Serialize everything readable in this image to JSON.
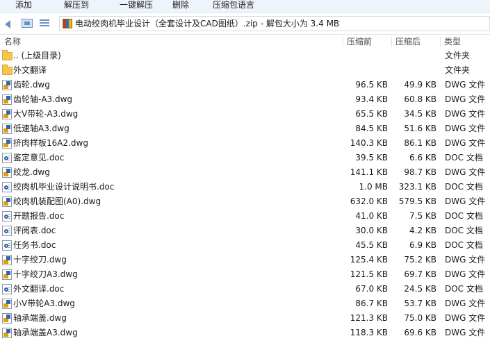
{
  "toolbar": {
    "buttons": [
      {
        "label": "添加"
      },
      {
        "label": "解压到"
      },
      {
        "label": "一键解压"
      },
      {
        "label": "删除"
      },
      {
        "label": "压缩包语言"
      }
    ]
  },
  "address": {
    "path": "电动绞肉机毕业设计（全套设计及CAD图纸）.zip - 解包大小为 3.4 MB"
  },
  "columns": {
    "name": "名称",
    "before": "压缩前",
    "after": "压缩后",
    "type": "类型"
  },
  "files": [
    {
      "name": ".. (上级目录)",
      "before": "",
      "after": "",
      "type": "文件夹",
      "icon": "folder-icon"
    },
    {
      "name": "外文翻译",
      "before": "",
      "after": "",
      "type": "文件夹",
      "icon": "folder-icon"
    },
    {
      "name": "齿轮.dwg",
      "before": "96.5 KB",
      "after": "49.9 KB",
      "type": "DWG 文件",
      "icon": "dwg-file-icon"
    },
    {
      "name": "齿轮轴-A3.dwg",
      "before": "93.4 KB",
      "after": "60.8 KB",
      "type": "DWG 文件",
      "icon": "dwg-file-icon"
    },
    {
      "name": "大V带轮-A3.dwg",
      "before": "65.5 KB",
      "after": "34.5 KB",
      "type": "DWG 文件",
      "icon": "dwg-file-icon"
    },
    {
      "name": "低速轴A3.dwg",
      "before": "84.5 KB",
      "after": "51.6 KB",
      "type": "DWG 文件",
      "icon": "dwg-file-icon"
    },
    {
      "name": "挤肉样板16A2.dwg",
      "before": "140.3 KB",
      "after": "86.1 KB",
      "type": "DWG 文件",
      "icon": "dwg-file-icon"
    },
    {
      "name": "鉴定意见.doc",
      "before": "39.5 KB",
      "after": "6.6 KB",
      "type": "DOC 文档",
      "icon": "doc-file-icon"
    },
    {
      "name": "绞龙.dwg",
      "before": "141.1 KB",
      "after": "98.7 KB",
      "type": "DWG 文件",
      "icon": "dwg-file-icon"
    },
    {
      "name": "绞肉机毕业设计说明书.doc",
      "before": "1.0 MB",
      "after": "323.1 KB",
      "type": "DOC 文档",
      "icon": "doc-file-icon"
    },
    {
      "name": "绞肉机装配图(A0).dwg",
      "before": "632.0 KB",
      "after": "579.5 KB",
      "type": "DWG 文件",
      "icon": "dwg-file-icon"
    },
    {
      "name": "开题报告.doc",
      "before": "41.0 KB",
      "after": "7.5 KB",
      "type": "DOC 文档",
      "icon": "doc-file-icon"
    },
    {
      "name": "评阅表.doc",
      "before": "30.0 KB",
      "after": "4.2 KB",
      "type": "DOC 文档",
      "icon": "doc-file-icon"
    },
    {
      "name": "任务书.doc",
      "before": "45.5 KB",
      "after": "6.9 KB",
      "type": "DOC 文档",
      "icon": "doc-file-icon"
    },
    {
      "name": "十字绞刀.dwg",
      "before": "125.4 KB",
      "after": "75.2 KB",
      "type": "DWG 文件",
      "icon": "dwg-file-icon"
    },
    {
      "name": "十字绞刀A3.dwg",
      "before": "121.5 KB",
      "after": "69.7 KB",
      "type": "DWG 文件",
      "icon": "dwg-file-icon"
    },
    {
      "name": "外文翻译.doc",
      "before": "67.0 KB",
      "after": "24.5 KB",
      "type": "DOC 文档",
      "icon": "doc-file-icon"
    },
    {
      "name": "小V带轮A3.dwg",
      "before": "86.7 KB",
      "after": "53.7 KB",
      "type": "DWG 文件",
      "icon": "dwg-file-icon"
    },
    {
      "name": "轴承端盖.dwg",
      "before": "121.3 KB",
      "after": "75.0 KB",
      "type": "DWG 文件",
      "icon": "dwg-file-icon"
    },
    {
      "name": "轴承端盖A3.dwg",
      "before": "118.3 KB",
      "after": "69.6 KB",
      "type": "DWG 文件",
      "icon": "dwg-file-icon"
    }
  ]
}
